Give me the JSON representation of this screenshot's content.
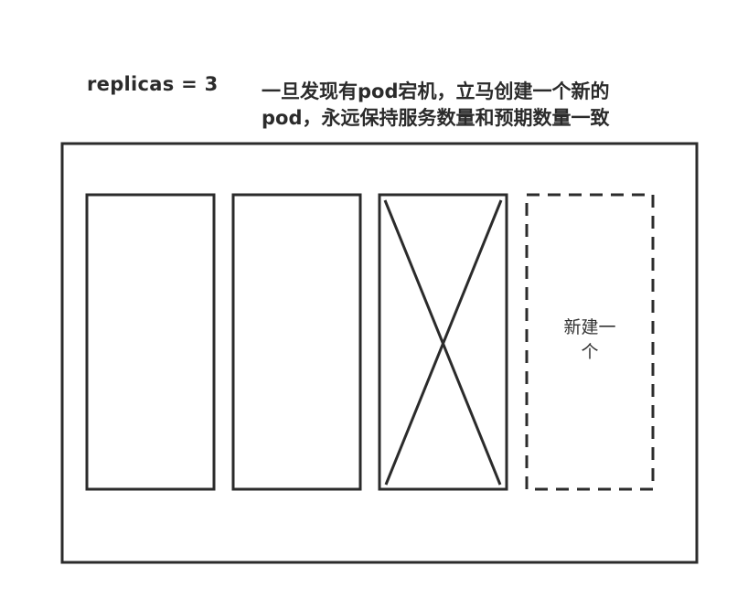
{
  "header": {
    "replicas_label": "replicas = 3",
    "note_line1": "一旦发现有pod宕机，立马创建一个新的",
    "note_line2": "pod，永远保持服务数量和预期数量一致"
  },
  "pods": [
    {
      "status": "running"
    },
    {
      "status": "running"
    },
    {
      "status": "crashed"
    },
    {
      "status": "new",
      "label_line1": "新建一",
      "label_line2": "个"
    }
  ],
  "colors": {
    "stroke": "#2b2b2b",
    "background": "#ffffff"
  }
}
